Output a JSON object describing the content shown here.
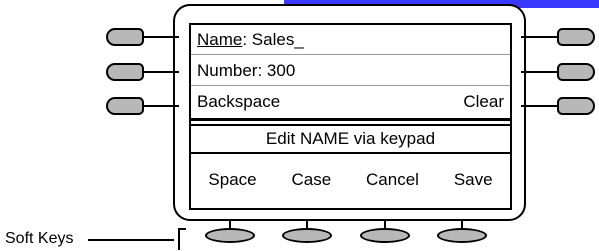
{
  "screen": {
    "name_label": "Name",
    "name_value": ": Sales_",
    "number_text": "Number: 300",
    "backspace_label": "Backspace",
    "clear_label": "Clear",
    "prompt_text": "Edit NAME via keypad"
  },
  "softkeys": [
    "Space",
    "Case",
    "Cancel",
    "Save"
  ],
  "callout": {
    "label": "Soft Keys"
  },
  "colors": {
    "key_fill": "#b8b8b8",
    "outline": "#000000",
    "top_bar": "#3a3aff"
  }
}
